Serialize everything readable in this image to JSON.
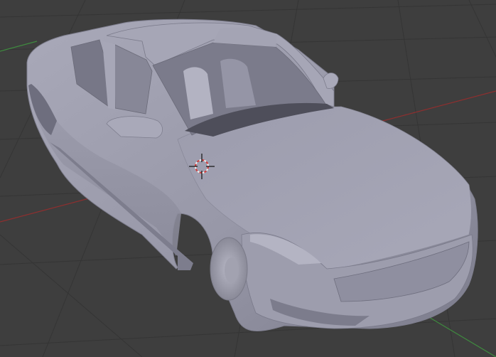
{
  "viewport": {
    "background": "#3e3e3e",
    "grid_color": "#353535",
    "x_axis_color": "#8e2f2f",
    "y_axis_color": "#3f8a3f",
    "mesh_color": "#9a9aab",
    "mesh_shadow": "#5e5e6c",
    "cursor_ring_color": "#d23a3a",
    "icons": {
      "scene_object": "car-mesh",
      "cursor": "3d-cursor-icon"
    }
  }
}
